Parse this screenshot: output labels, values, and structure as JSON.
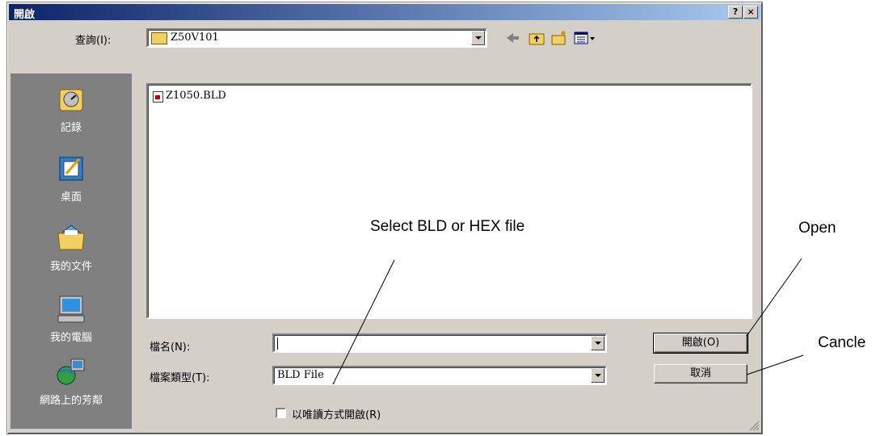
{
  "window": {
    "title": "開啟",
    "help_label": "?",
    "close_label": "×"
  },
  "toolbar": {
    "look_in_label": "查詢(I):",
    "look_in_value": "Z50V101",
    "icons": [
      "back-arrow-icon",
      "up-folder-icon",
      "new-folder-icon",
      "view-menu-icon"
    ]
  },
  "places": [
    {
      "label": "記錄",
      "icon": "history-icon"
    },
    {
      "label": "桌面",
      "icon": "desktop-icon"
    },
    {
      "label": "我的文件",
      "icon": "my-documents-icon"
    },
    {
      "label": "我的電腦",
      "icon": "my-computer-icon"
    },
    {
      "label": "網路上的芳鄰",
      "icon": "network-places-icon"
    }
  ],
  "file_list": [
    {
      "name": "Z1050.BLD",
      "icon": "bld-file-icon"
    }
  ],
  "fields": {
    "filename_label": "檔名(N):",
    "filename_value": "",
    "filetype_label": "檔案類型(T):",
    "filetype_value": "BLD File",
    "readonly_label": "以唯讀方式開啟(R)"
  },
  "buttons": {
    "open": "開啟(O)",
    "cancel": "取消"
  },
  "annotations": {
    "select": "Select BLD or HEX file",
    "open": "Open",
    "cancel": "Cancle"
  }
}
